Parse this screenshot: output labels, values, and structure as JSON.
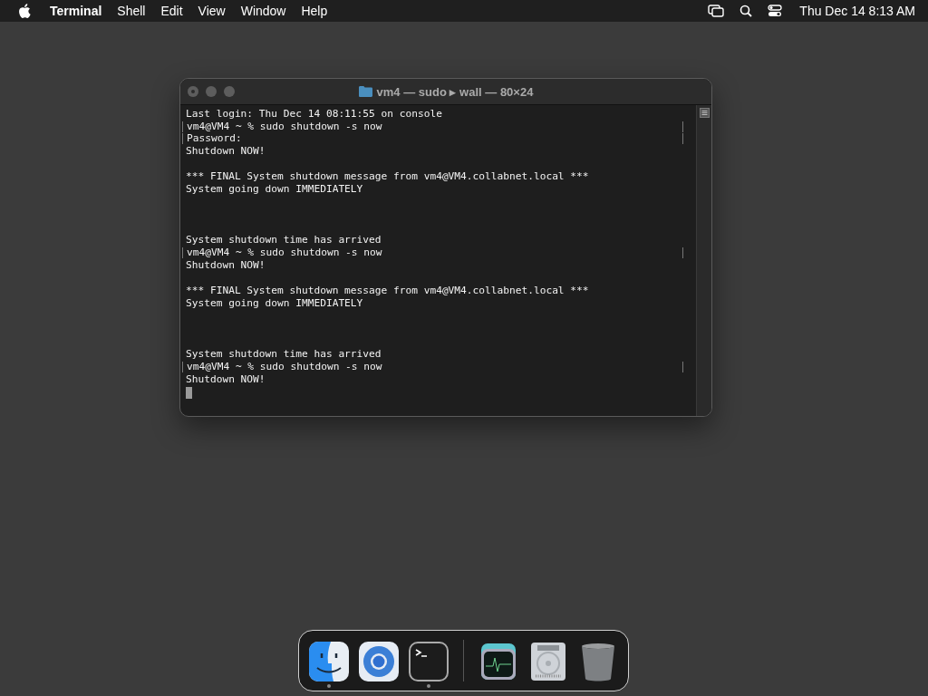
{
  "menu_bar": {
    "app_name": "Terminal",
    "menus": [
      "Shell",
      "Edit",
      "View",
      "Window",
      "Help"
    ],
    "clock": "Thu Dec 14  8:13 AM"
  },
  "window": {
    "title": "vm4 — sudo ▸ wall — 80×24",
    "lines": [
      {
        "kind": "output",
        "text": "Last login: Thu Dec 14 08:11:55 on console"
      },
      {
        "kind": "command",
        "text": "vm4@VM4 ~ % sudo shutdown -s now"
      },
      {
        "kind": "command",
        "text": "Password:"
      },
      {
        "kind": "output",
        "text": "Shutdown NOW!"
      },
      {
        "kind": "blank"
      },
      {
        "kind": "output",
        "text": "*** FINAL System shutdown message from vm4@VM4.collabnet.local ***"
      },
      {
        "kind": "output",
        "text": "System going down IMMEDIATELY"
      },
      {
        "kind": "blank"
      },
      {
        "kind": "blank"
      },
      {
        "kind": "blank"
      },
      {
        "kind": "output",
        "text": "System shutdown time has arrived"
      },
      {
        "kind": "command",
        "text": "vm4@VM4 ~ % sudo shutdown -s now"
      },
      {
        "kind": "output",
        "text": "Shutdown NOW!"
      },
      {
        "kind": "blank"
      },
      {
        "kind": "output",
        "text": "*** FINAL System shutdown message from vm4@VM4.collabnet.local ***"
      },
      {
        "kind": "output",
        "text": "System going down IMMEDIATELY"
      },
      {
        "kind": "blank"
      },
      {
        "kind": "blank"
      },
      {
        "kind": "blank"
      },
      {
        "kind": "output",
        "text": "System shutdown time has arrived"
      },
      {
        "kind": "command",
        "text": "vm4@VM4 ~ % sudo shutdown -s now"
      },
      {
        "kind": "output",
        "text": "Shutdown NOW!"
      },
      {
        "kind": "cursor"
      }
    ]
  },
  "dock": {
    "items": [
      {
        "kind": "finder",
        "running": true
      },
      {
        "kind": "browser",
        "running": false
      },
      {
        "kind": "terminal",
        "running": true
      },
      {
        "kind": "divider"
      },
      {
        "kind": "monitor",
        "running": false
      },
      {
        "kind": "disk",
        "running": false
      },
      {
        "kind": "trash",
        "running": false
      }
    ]
  }
}
